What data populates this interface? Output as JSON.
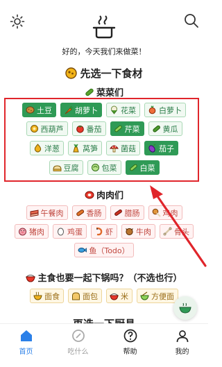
{
  "header": {
    "greeting": "好的，今天我们来做菜！"
  },
  "section_title": "先选一下食材",
  "vegetables": {
    "title": "菜菜们",
    "rows": [
      [
        {
          "label": "土豆",
          "icon": "potato-icon",
          "selected": true
        },
        {
          "label": "胡萝卜",
          "icon": "carrot-icon",
          "selected": true
        },
        {
          "label": "花菜",
          "icon": "cauliflower-icon",
          "selected": false
        },
        {
          "label": "白萝卜",
          "icon": "white-radish-icon",
          "selected": false
        }
      ],
      [
        {
          "label": "西葫芦",
          "icon": "zucchini-icon",
          "selected": false
        },
        {
          "label": "番茄",
          "icon": "tomato-icon",
          "selected": false
        },
        {
          "label": "芹菜",
          "icon": "celery-icon",
          "selected": true
        },
        {
          "label": "黄瓜",
          "icon": "cucumber-icon",
          "selected": false
        }
      ],
      [
        {
          "label": "洋葱",
          "icon": "onion-icon",
          "selected": false
        },
        {
          "label": "莴笋",
          "icon": "lettuce-stem-icon",
          "selected": false
        },
        {
          "label": "菌菇",
          "icon": "mushroom-icon",
          "selected": false
        },
        {
          "label": "茄子",
          "icon": "eggplant-icon",
          "selected": true
        }
      ],
      [
        {
          "label": "豆腐",
          "icon": "tofu-icon",
          "selected": false
        },
        {
          "label": "包菜",
          "icon": "cabbage-icon",
          "selected": false
        },
        {
          "label": "白菜",
          "icon": "bok-choy-icon",
          "selected": true
        }
      ]
    ]
  },
  "meats": {
    "title": "肉肉们",
    "rows": [
      [
        {
          "label": "午餐肉",
          "icon": "luncheon-meat-icon"
        },
        {
          "label": "香肠",
          "icon": "sausage-icon"
        },
        {
          "label": "腊肠",
          "icon": "chinese-sausage-icon"
        },
        {
          "label": "鸡肉",
          "icon": "chicken-icon"
        }
      ],
      [
        {
          "label": "猪肉",
          "icon": "pork-icon"
        },
        {
          "label": "鸡蛋",
          "icon": "egg-icon"
        },
        {
          "label": "虾",
          "icon": "shrimp-icon"
        },
        {
          "label": "牛肉",
          "icon": "beef-icon"
        },
        {
          "label": "骨头",
          "icon": "bone-icon"
        }
      ],
      [
        {
          "label": "鱼（Todo）",
          "icon": "fish-icon"
        }
      ]
    ]
  },
  "staples": {
    "title": "主食也要一起下锅吗？（不选也行）",
    "items": [
      {
        "label": "面食",
        "icon": "noodles-icon"
      },
      {
        "label": "面包",
        "icon": "bread-icon"
      },
      {
        "label": "米",
        "icon": "rice-icon"
      },
      {
        "label": "方便面",
        "icon": "instant-noodles-icon"
      }
    ]
  },
  "next_section_peek": "再选一下厨具",
  "tabs": [
    {
      "label": "首页",
      "icon": "home-icon",
      "active": true
    },
    {
      "label": "吃什么",
      "icon": "dice-icon",
      "active": false
    },
    {
      "label": "帮助",
      "icon": "help-icon",
      "active": false
    },
    {
      "label": "我的",
      "icon": "user-icon",
      "active": false
    }
  ],
  "colors": {
    "selected_green": "#2f9a56",
    "highlight_red": "#e0252b",
    "tab_active_blue": "#2b80e8"
  }
}
